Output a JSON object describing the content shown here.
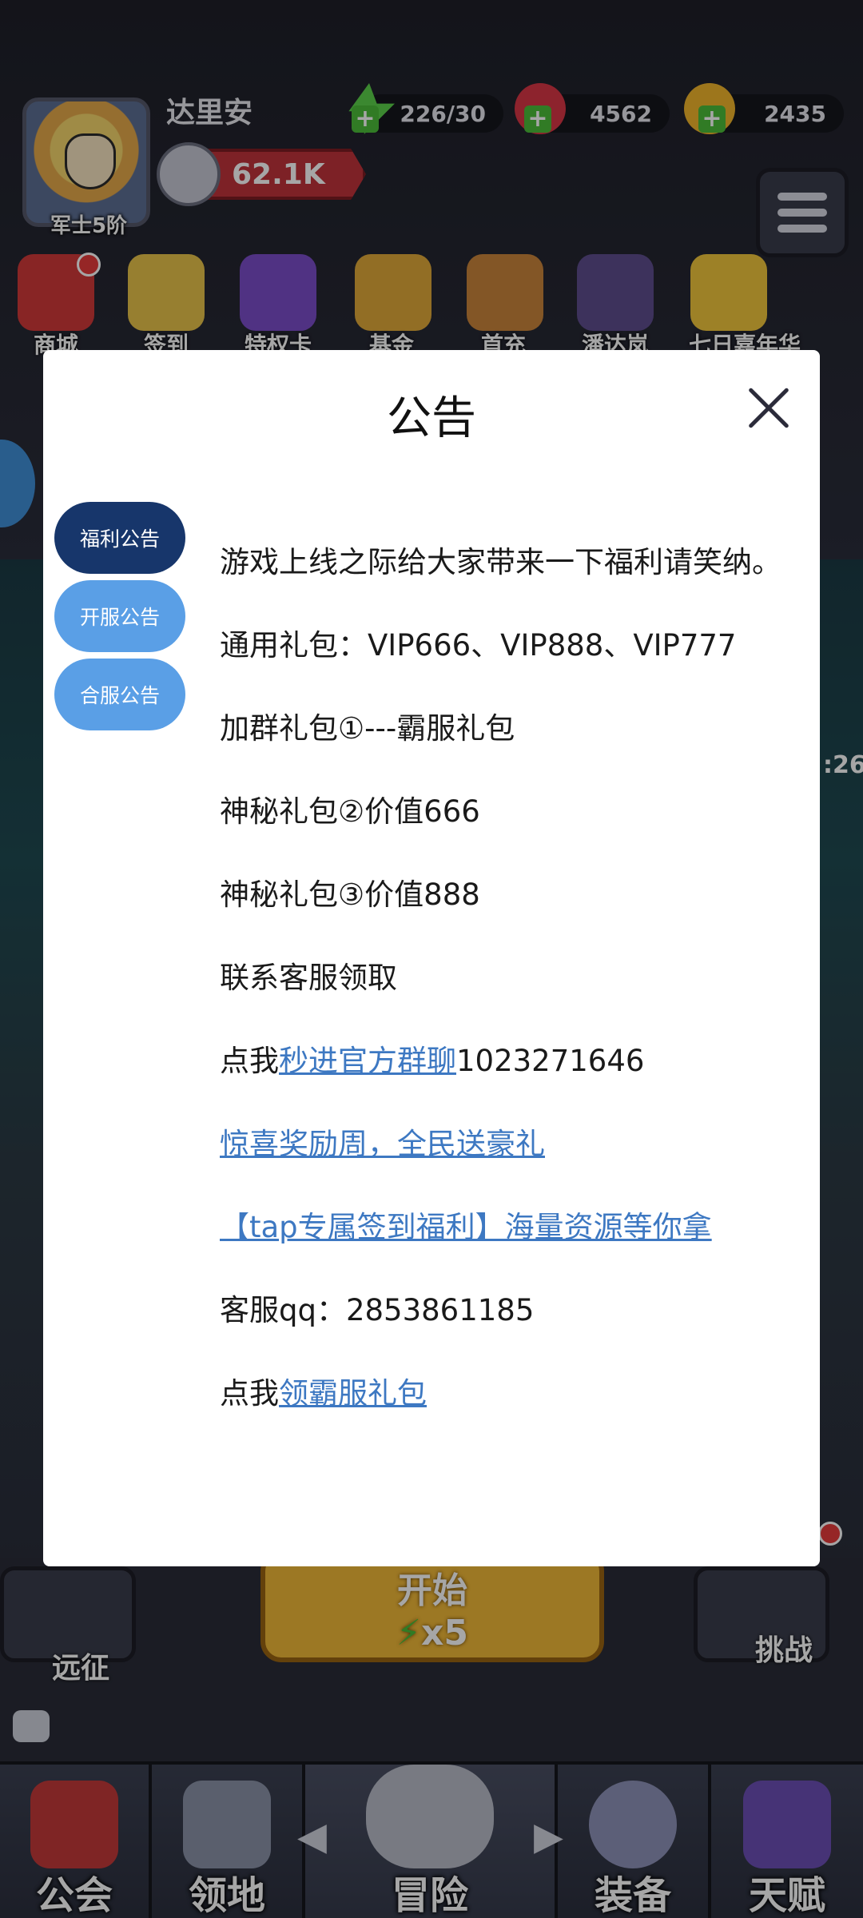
{
  "player": {
    "name": "达里安",
    "rank": "军士5阶",
    "power": "62.1K"
  },
  "resources": {
    "energy": "226/30",
    "gems": "4562",
    "gold": "2435"
  },
  "top_menu": [
    "商城",
    "签到",
    "特权卡",
    "基金",
    "首充",
    "潘达岚",
    "七日嘉年华"
  ],
  "timer_fragment": ":26",
  "start_button": {
    "label": "开始",
    "cost": "x5"
  },
  "side_buttons": {
    "left": "远征",
    "right": "挑战"
  },
  "bottom_nav": [
    "公会",
    "领地",
    "冒险",
    "装备",
    "天赋"
  ],
  "notice": {
    "title": "公告",
    "tabs": [
      {
        "label": "福利公告",
        "active": true
      },
      {
        "label": "开服公告",
        "active": false
      },
      {
        "label": "合服公告",
        "active": false
      }
    ],
    "intro": "游戏上线之际给大家带来一下福利请笑纳。",
    "general_gift": "通用礼包：VIP666、VIP888、VIP777",
    "group_gift": "加群礼包①---霸服礼包",
    "mystery_gift_2": "神秘礼包②价值666",
    "mystery_gift_3": "神秘礼包③价值888",
    "contact_service": "联系客服领取",
    "group_join_prefix": "点我",
    "group_join_link": "秒进官方群聊",
    "group_number": "1023271646",
    "surprise_link": "惊喜奖励周，全民送豪礼",
    "tap_link": "【tap专属签到福利】海量资源等你拿",
    "service_qq": "客服qq：2853861185",
    "claim_prefix": "点我",
    "claim_link": "领霸服礼包"
  },
  "colors": {
    "tab_active": "#17366b",
    "tab_inactive": "#5a9fe6",
    "link": "#3d78c2"
  }
}
